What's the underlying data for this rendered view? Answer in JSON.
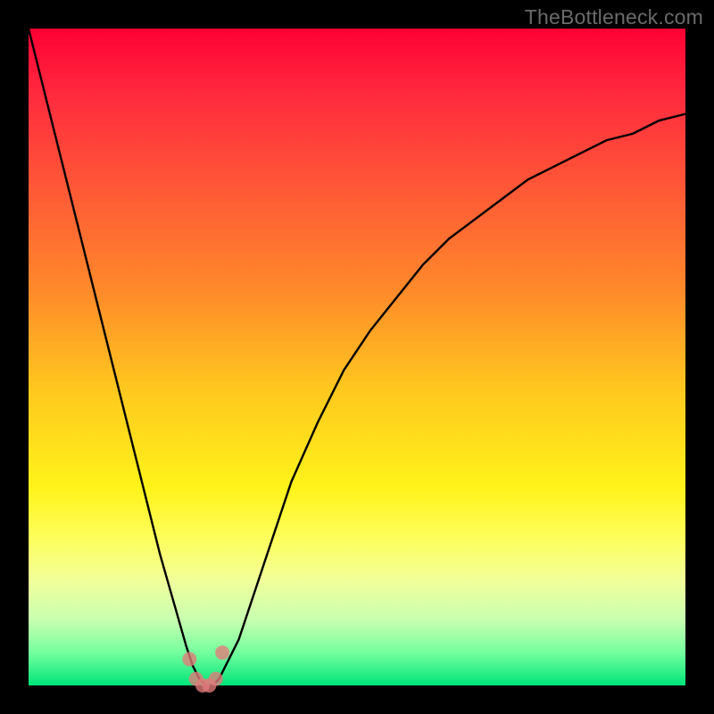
{
  "watermark": "TheBottleneck.com",
  "colors": {
    "frame": "#000000",
    "curve": "#000000",
    "marker": "#e47a7a",
    "gradient_top": "#ff0034",
    "gradient_bottom": "#00e47a"
  },
  "chart_data": {
    "type": "line",
    "title": "",
    "xlabel": "",
    "ylabel": "",
    "xlim": [
      0,
      100
    ],
    "ylim": [
      0,
      100
    ],
    "x": [
      0,
      2,
      4,
      6,
      8,
      10,
      12,
      14,
      16,
      18,
      20,
      22,
      24,
      25,
      26,
      27,
      28,
      29,
      30,
      32,
      34,
      36,
      38,
      40,
      44,
      48,
      52,
      56,
      60,
      64,
      68,
      72,
      76,
      80,
      84,
      88,
      92,
      96,
      100
    ],
    "y": [
      100,
      92,
      84,
      76,
      68,
      60,
      52,
      44,
      36,
      28,
      20,
      13,
      6,
      3,
      1,
      0,
      0,
      1,
      3,
      7,
      13,
      19,
      25,
      31,
      40,
      48,
      54,
      59,
      64,
      68,
      71,
      74,
      77,
      79,
      81,
      83,
      84,
      86,
      87
    ],
    "minimum_x": 27,
    "markers": [
      {
        "x": 24.5,
        "y": 4
      },
      {
        "x": 25.5,
        "y": 1
      },
      {
        "x": 26.5,
        "y": 0
      },
      {
        "x": 27.5,
        "y": 0
      },
      {
        "x": 28.5,
        "y": 1
      },
      {
        "x": 29.5,
        "y": 5
      }
    ]
  }
}
